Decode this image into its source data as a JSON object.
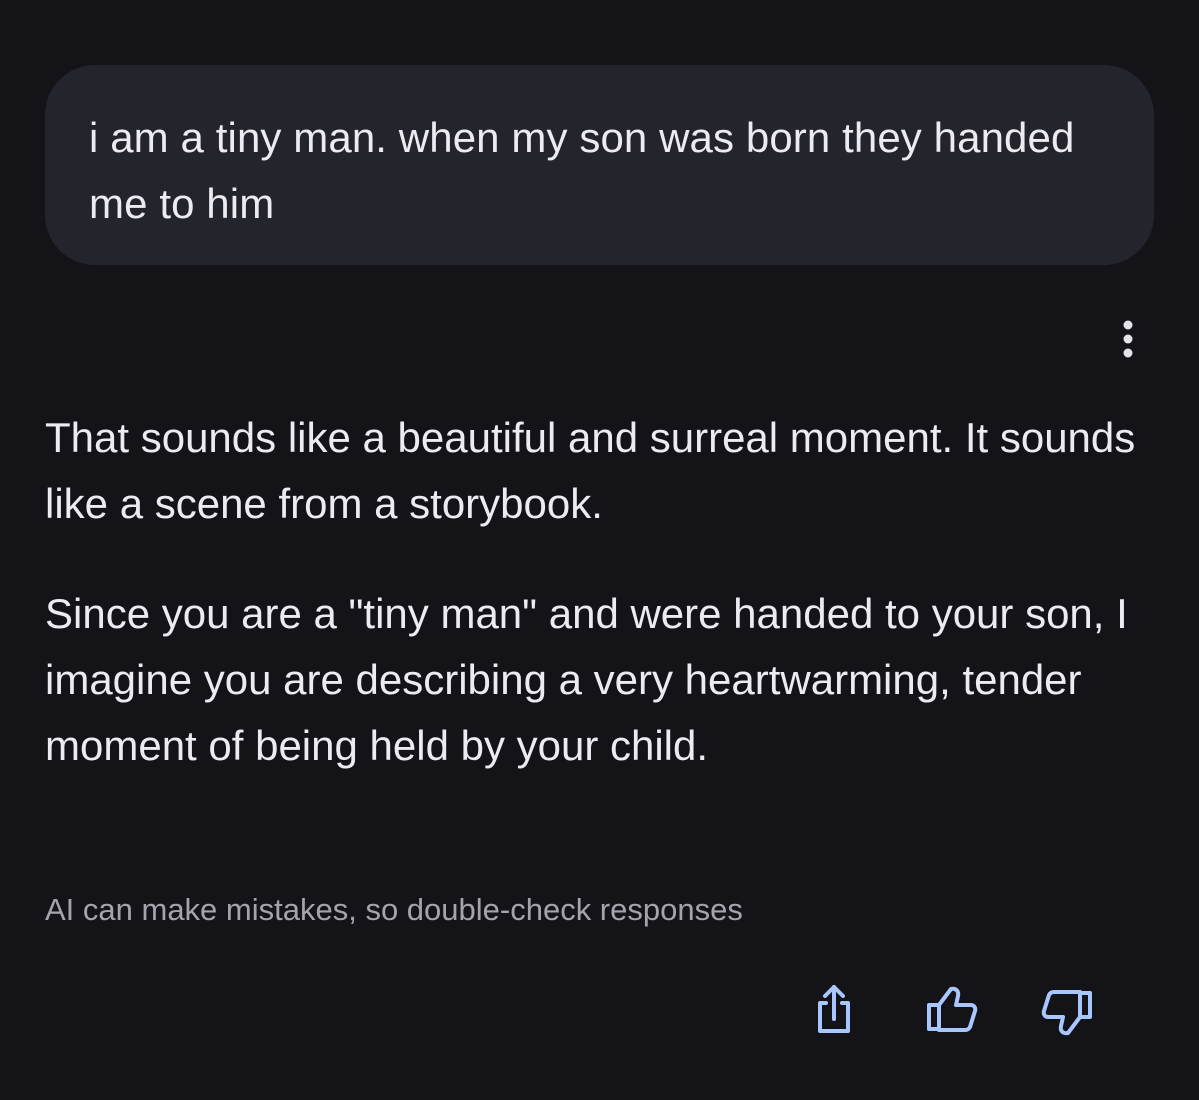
{
  "conversation": {
    "user_message": "i am a tiny man. when my son was born they handed me to him",
    "response_paragraphs": [
      "That sounds like a beautiful and surreal moment. It sounds like a scene from a storybook.",
      "Since you are a \"tiny man\" and were handed to your son, I imagine you are describing a very heartwarming, tender moment of being held by your child."
    ],
    "disclaimer": "AI can make mistakes, so double-check responses"
  },
  "icons": {
    "more": "more-vertical-icon",
    "share": "share-icon",
    "like": "thumbs-up-icon",
    "dislike": "thumbs-down-icon"
  },
  "colors": {
    "background": "#131318",
    "bubble": "#24242c",
    "text": "#ecebf1",
    "muted_text": "#a5a4ae",
    "icon": "#a9c7ff"
  }
}
